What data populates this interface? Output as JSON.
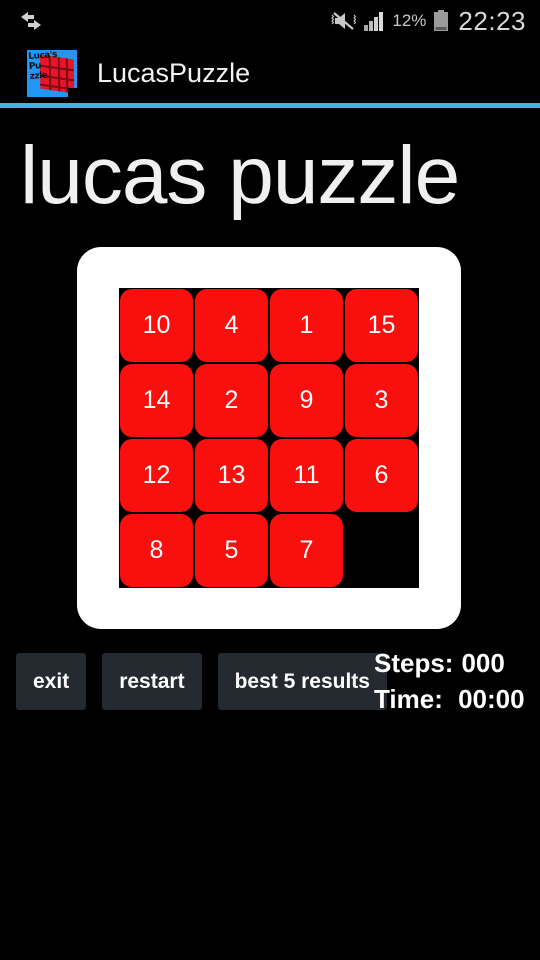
{
  "status_bar": {
    "left_icon": "back-forward-arrows-icon",
    "sound_icon": "mute-vibrate-icon",
    "signal_icon": "signal-bars-icon",
    "battery_percent": "12%",
    "battery_icon": "battery-icon",
    "clock": "22:23"
  },
  "action_bar": {
    "app_icon": "lucaspuzzle-app-icon",
    "app_icon_text_line1": "Luca's",
    "app_icon_text_line2": "Pu",
    "app_icon_text_line3": "zzle",
    "title": "LucasPuzzle",
    "divider_color": "#3fb6e0"
  },
  "page": {
    "title": "lucas puzzle",
    "background_color": "#000000"
  },
  "puzzle": {
    "card_color": "#ffffff",
    "tile_color": "#fa0f0f",
    "tile_text_color": "#ffffff",
    "rows": 4,
    "cols": 4,
    "tiles": [
      {
        "label": "10",
        "blank": false
      },
      {
        "label": "4",
        "blank": false
      },
      {
        "label": "1",
        "blank": false
      },
      {
        "label": "15",
        "blank": false
      },
      {
        "label": "14",
        "blank": false
      },
      {
        "label": "2",
        "blank": false
      },
      {
        "label": "9",
        "blank": false
      },
      {
        "label": "3",
        "blank": false
      },
      {
        "label": "12",
        "blank": false
      },
      {
        "label": "13",
        "blank": false
      },
      {
        "label": "11",
        "blank": false
      },
      {
        "label": "6",
        "blank": false
      },
      {
        "label": "8",
        "blank": false
      },
      {
        "label": "5",
        "blank": false
      },
      {
        "label": "7",
        "blank": false
      },
      {
        "label": "",
        "blank": true
      }
    ]
  },
  "controls": {
    "exit_label": "exit",
    "restart_label": "restart",
    "best_results_label": "best 5 results",
    "button_color": "#252a30"
  },
  "stats": {
    "steps_label": "Steps:",
    "steps_value": "000",
    "time_label": "Time:",
    "time_value": " 00:00"
  }
}
